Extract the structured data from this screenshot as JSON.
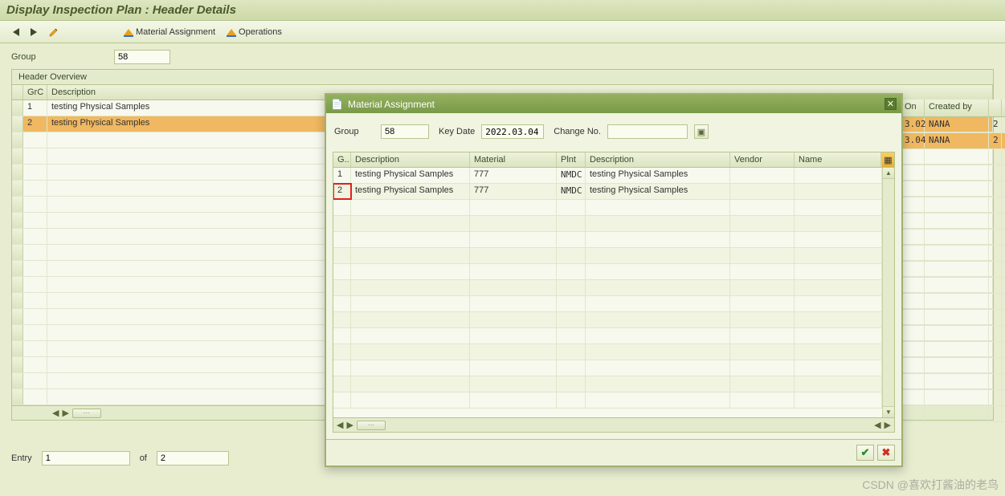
{
  "title": "Display Inspection Plan : Header Details",
  "toolbar": {
    "material_assignment": "Material Assignment",
    "operations": "Operations"
  },
  "group_label": "Group",
  "group_value": "58",
  "panel_title": "Header Overview",
  "bg_table": {
    "headers": {
      "grc": "GrC",
      "desc": "Description",
      "on": "On",
      "created_by": "Created by"
    },
    "rows": [
      {
        "grc": "1",
        "desc": "testing Physical Samples",
        "on": "3.02",
        "created_by": "NANA",
        "trail": "2",
        "selected": false
      },
      {
        "grc": "2",
        "desc": "testing Physical Samples",
        "on": "3.04",
        "created_by": "NANA",
        "trail": "2",
        "selected": true
      }
    ]
  },
  "entry": {
    "label": "Entry",
    "from": "1",
    "of_label": "of",
    "to": "2"
  },
  "dialog": {
    "title": "Material Assignment",
    "fields": {
      "group_label": "Group",
      "group_value": "58",
      "keydate_label": "Key Date",
      "keydate_value": "2022.03.04",
      "change_label": "Change No.",
      "change_value": ""
    },
    "headers": {
      "g": "G..",
      "desc": "Description",
      "material": "Material",
      "plnt": "Plnt",
      "desc2": "Description",
      "vendor": "Vendor",
      "name": "Name"
    },
    "rows": [
      {
        "g": "1",
        "desc": "testing Physical Samples",
        "material": "777",
        "plnt": "NMDC",
        "desc2": "testing Physical Samples",
        "vendor": "",
        "name": "",
        "highlight": false
      },
      {
        "g": "2",
        "desc": "testing Physical Samples",
        "material": "777",
        "plnt": "NMDC",
        "desc2": "testing Physical Samples",
        "vendor": "",
        "name": "",
        "highlight": true
      }
    ]
  },
  "watermark": "CSDN @喜欢打酱油的老鸟"
}
